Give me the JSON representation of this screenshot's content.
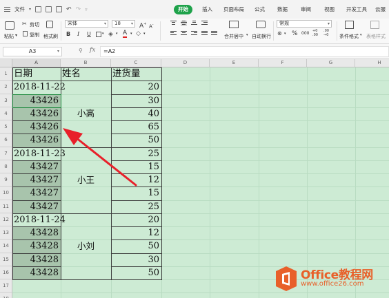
{
  "menubar": {
    "file_label": "文件",
    "tabs": [
      {
        "label": "开始",
        "active": true
      },
      {
        "label": "插入",
        "active": false
      },
      {
        "label": "页面布局",
        "active": false
      },
      {
        "label": "公式",
        "active": false
      },
      {
        "label": "数据",
        "active": false
      },
      {
        "label": "审阅",
        "active": false
      },
      {
        "label": "视图",
        "active": false
      },
      {
        "label": "开发工具",
        "active": false
      },
      {
        "label": "云服",
        "active": false
      }
    ]
  },
  "ribbon": {
    "paste_label": "粘贴",
    "cut_label": "剪切",
    "copy_label": "复制",
    "format_painter_label": "格式刷",
    "font_name": "宋体",
    "font_size": "18",
    "grow_font": "A",
    "shrink_font": "A",
    "bold": "B",
    "italic": "I",
    "underline": "U",
    "merge_center_label": "合并居中",
    "wrap_text_label": "自动换行",
    "number_format": "常规",
    "percent": "%",
    "thousands": "000",
    "dec_increase": "+0 .00",
    "dec_decrease": ".00 →0",
    "conditional_format_label": "条件格式",
    "table_style_label": "表格样式"
  },
  "formula_bar": {
    "cell_ref": "A3",
    "fx": "fx",
    "formula": "=A2"
  },
  "grid": {
    "columns": [
      "A",
      "B",
      "C",
      "D",
      "E",
      "F",
      "G",
      "H"
    ],
    "rows": [
      "1",
      "2",
      "3",
      "4",
      "5",
      "6",
      "7",
      "8",
      "9",
      "10",
      "11",
      "12",
      "13",
      "14",
      "15",
      "16",
      "17",
      "18"
    ],
    "header": {
      "date": "日期",
      "name": "姓名",
      "qty": "进货量"
    },
    "dates": {
      "2": "2018-11-22",
      "7": "2018-11-23",
      "12": "2018-11-24"
    },
    "serials": {
      "3": "43426",
      "4": "43426",
      "5": "43426",
      "6": "43426",
      "8": "43427",
      "9": "43427",
      "10": "43427",
      "11": "43427",
      "13": "43428",
      "14": "43428",
      "15": "43428",
      "16": "43428"
    },
    "names": [
      "小高",
      "小王",
      "小刘"
    ],
    "quantities": [
      "20",
      "30",
      "40",
      "65",
      "50",
      "25",
      "15",
      "12",
      "15",
      "25",
      "20",
      "12",
      "50",
      "30",
      "50"
    ]
  },
  "watermark": {
    "title": "Office教程网",
    "url": "www.office26.com"
  },
  "colors": {
    "accent_tab": "#1ea24a",
    "sheet_background": "#cdebd4",
    "arrow": "#e8202a",
    "watermark": "#e8602a"
  }
}
